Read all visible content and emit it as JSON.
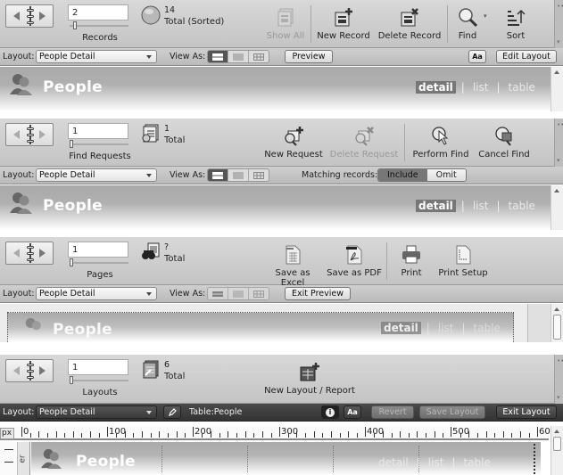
{
  "panels": [
    {
      "mode": "browse",
      "record_field": "2",
      "record_label": "Records",
      "count": "14",
      "count_label": "Total (Sorted)",
      "buttons": [
        {
          "label": "Show All",
          "icon": "show-all-icon",
          "disabled": true
        },
        {
          "label": "New Record",
          "icon": "new-record-icon",
          "disabled": false
        },
        {
          "label": "Delete Record",
          "icon": "delete-record-icon",
          "disabled": false
        },
        {
          "label": "Find",
          "icon": "find-magnifier-icon",
          "disabled": false
        },
        {
          "label": "Sort",
          "icon": "sort-icon",
          "disabled": false
        }
      ],
      "layout_label": "Layout:",
      "layout_value": "People Detail",
      "view_as_label": "View As:",
      "preview_button": "Preview",
      "format_button": "Aa",
      "edit_layout_button": "Edit Layout",
      "title": "People",
      "tabs": [
        "detail",
        "list",
        "table"
      ]
    },
    {
      "mode": "find",
      "record_field": "1",
      "record_label": "Find Requests",
      "count": "1",
      "count_label": "Total",
      "buttons": [
        {
          "label": "New Request",
          "icon": "new-request-icon",
          "disabled": false
        },
        {
          "label": "Delete Request",
          "icon": "delete-request-icon",
          "disabled": true
        },
        {
          "label": "Perform Find",
          "icon": "perform-find-icon",
          "disabled": false
        },
        {
          "label": "Cancel Find",
          "icon": "cancel-find-icon",
          "disabled": false
        }
      ],
      "layout_label": "Layout:",
      "layout_value": "People Detail",
      "view_as_label": "View As:",
      "matching_label": "Matching records:",
      "include_button": "Include",
      "omit_button": "Omit",
      "title": "People",
      "tabs": [
        "detail",
        "list",
        "table"
      ]
    },
    {
      "mode": "preview",
      "record_field": "1",
      "record_label": "Pages",
      "count": "?",
      "count_label": "Total",
      "buttons": [
        {
          "label": "Save as Excel",
          "icon": "excel-icon",
          "disabled": false
        },
        {
          "label": "Save as PDF",
          "icon": "pdf-icon",
          "disabled": false
        },
        {
          "label": "Print",
          "icon": "printer-icon",
          "disabled": false
        },
        {
          "label": "Print Setup",
          "icon": "print-setup-icon",
          "disabled": false
        }
      ],
      "layout_label": "Layout:",
      "layout_value": "People Detail",
      "view_as_label": "View As:",
      "exit_preview_button": "Exit Preview",
      "title": "People",
      "tabs": [
        "detail",
        "list",
        "table"
      ]
    },
    {
      "mode": "layout",
      "record_field": "1",
      "record_label": "Layouts",
      "count": "6",
      "count_label": "Total",
      "buttons": [
        {
          "label": "New Layout / Report",
          "icon": "new-layout-icon",
          "disabled": false
        }
      ],
      "layout_label": "Layout:",
      "layout_value": "People Detail",
      "table_label": "Table:People",
      "info_button": "i",
      "format_button": "Aa",
      "revert_button": "Revert",
      "save_layout_button": "Save Layout",
      "exit_layout_button": "Exit Layout",
      "ruler_unit": "px",
      "ruler_labels": [
        "0",
        "100",
        "200",
        "300",
        "400",
        "500",
        "60"
      ],
      "part_label": "er",
      "title": "People",
      "tabs": [
        "detail",
        "list",
        "table"
      ]
    }
  ]
}
